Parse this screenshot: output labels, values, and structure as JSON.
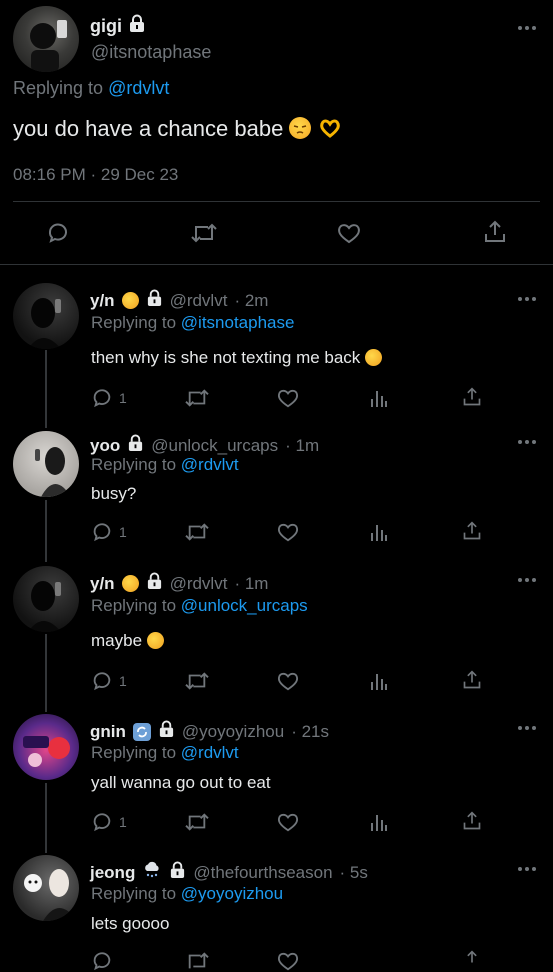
{
  "main_tweet": {
    "name": "gigi",
    "handle": "@itsnotaphase",
    "replying_prefix": "Replying to ",
    "replying_to": "@rdvlvt",
    "text": "you do have a chance babe",
    "emojis": [
      "pensive-face-emoji",
      "heart-hands-emoji"
    ],
    "timestamp": "08:16 PM · 29 Dec 23"
  },
  "replies": [
    {
      "name": "y/n",
      "handle": "@rdvlvt",
      "time": "· 2m",
      "replying_prefix": "Replying to ",
      "replying_to": "@itsnotaphase",
      "text": "then why is she not texting me back",
      "reply_count": "1"
    },
    {
      "name": "yoo",
      "handle": "@unlock_urcaps",
      "time": "· 1m",
      "replying_prefix": "Replying to ",
      "replying_to": "@rdvlvt",
      "text": "busy?",
      "reply_count": "1"
    },
    {
      "name": "y/n",
      "handle": "@rdvlvt",
      "time": "· 1m",
      "replying_prefix": "Replying to ",
      "replying_to": "@unlock_urcaps",
      "text": "maybe",
      "reply_count": "1"
    },
    {
      "name": "gnin",
      "handle": "@yoyoyizhou",
      "time": "· 21s",
      "replying_prefix": "Replying to ",
      "replying_to": "@rdvlvt",
      "text": "yall wanna go out to eat",
      "reply_count": "1"
    },
    {
      "name": "jeong",
      "handle": "@thefourthseason",
      "time": "· 5s",
      "replying_prefix": "Replying to ",
      "replying_to": "@yoyoyizhou",
      "text": "lets goooo",
      "reply_count": ""
    }
  ],
  "colors": {
    "background": "#000000",
    "text": "#e7e9ea",
    "muted": "#71767b",
    "link": "#1d9bf0",
    "divider": "#2f3336"
  }
}
